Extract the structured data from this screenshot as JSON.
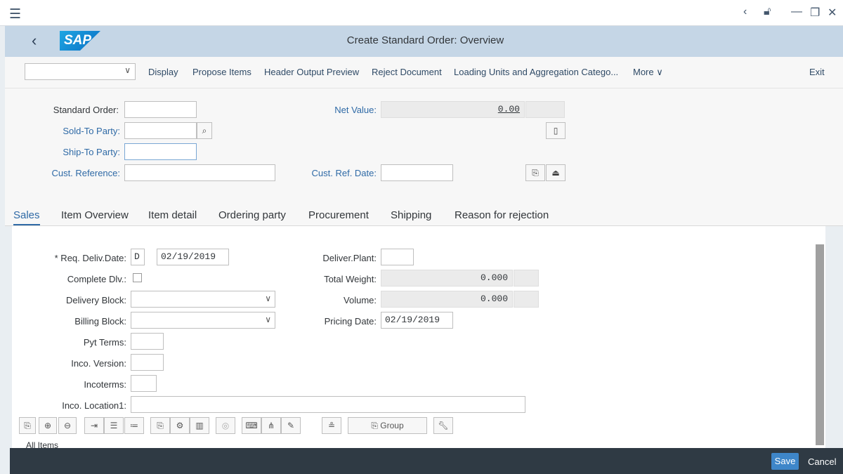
{
  "shell": {
    "menu_icon": "hamburger-icon",
    "back_icon": "back-arrow-icon",
    "window_controls": [
      "chevron-left-icon",
      "lock-icon",
      "minimize-icon",
      "restore-icon",
      "close-icon"
    ],
    "logo_text": "SAP",
    "title": "Create Standard Order: Overview"
  },
  "toolbar": {
    "dropdown_value": "",
    "display": "Display",
    "propose_items": "Propose Items",
    "header_output_preview": "Header Output Preview",
    "reject_document": "Reject Document",
    "loading_units": "Loading Units and Aggregation Catego...",
    "more": "More",
    "exit": "Exit"
  },
  "header_form": {
    "standard_order_label": "Standard Order:",
    "standard_order_value": "",
    "sold_to_label": "Sold-To Party:",
    "sold_to_value": "",
    "ship_to_label": "Ship-To Party:",
    "ship_to_value": "",
    "cust_ref_label": "Cust. Reference:",
    "cust_ref_value": "",
    "net_value_label": "Net Value:",
    "net_value": "0.00",
    "cust_ref_date_label": "Cust. Ref. Date:",
    "cust_ref_date_value": ""
  },
  "tabs": [
    {
      "label": "Sales",
      "active": true
    },
    {
      "label": "Item Overview",
      "active": false
    },
    {
      "label": "Item detail",
      "active": false
    },
    {
      "label": "Ordering party",
      "active": false
    },
    {
      "label": "Procurement",
      "active": false
    },
    {
      "label": "Shipping",
      "active": false
    },
    {
      "label": "Reason for rejection",
      "active": false
    }
  ],
  "sales": {
    "req_deliv_label": "* Req. Deliv.Date:",
    "req_deliv_period": "D",
    "req_deliv_date": "02/19/2019",
    "complete_dlv_label": "Complete Dlv.:",
    "delivery_block_label": "Delivery Block:",
    "delivery_block_value": "",
    "billing_block_label": "Billing Block:",
    "billing_block_value": "",
    "pyt_terms_label": "Pyt Terms:",
    "pyt_terms_value": "",
    "inco_version_label": "Inco. Version:",
    "inco_version_value": "",
    "incoterms_label": "Incoterms:",
    "incoterms_value": "",
    "inco_location_label": "Inco. Location1:",
    "inco_location_value": "",
    "deliver_plant_label": "Deliver.Plant:",
    "deliver_plant_value": "",
    "total_weight_label": "Total Weight:",
    "total_weight": "0.000",
    "volume_label": "Volume:",
    "volume": "0.000",
    "pricing_date_label": "Pricing Date:",
    "pricing_date": "02/19/2019"
  },
  "item_toolbar": {
    "group_label": "Group",
    "all_items_label": "All Items"
  },
  "footer": {
    "save": "Save",
    "cancel": "Cancel"
  }
}
